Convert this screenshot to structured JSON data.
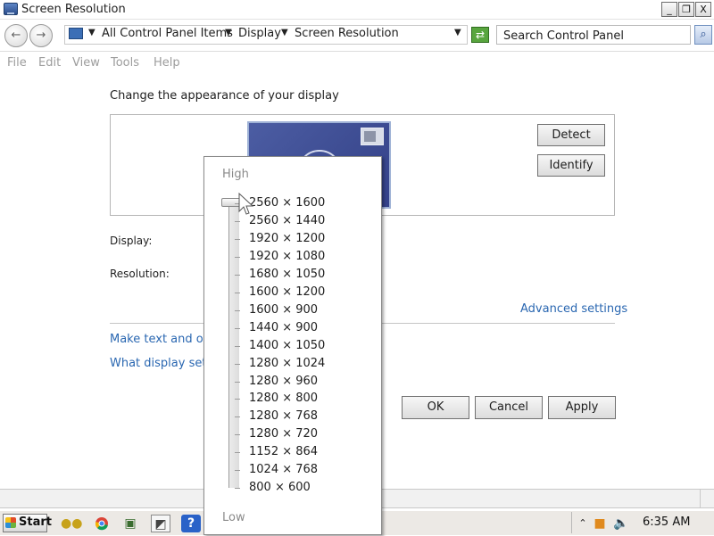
{
  "window": {
    "title": "Screen Resolution",
    "controls": {
      "minimize": "_",
      "restore": "❐",
      "close": "X"
    }
  },
  "address_bar": {
    "breadcrumbs": [
      "All Control Panel Items",
      "Display",
      "Screen Resolution"
    ],
    "search_placeholder": "Search Control Panel"
  },
  "menu": [
    "File",
    "Edit",
    "View",
    "Tools",
    "Help"
  ],
  "content": {
    "heading": "Change the appearance of your display",
    "detect_label": "Detect",
    "identify_label": "Identify",
    "display_label": "Display:",
    "resolution_label": "Resolution:",
    "advanced_link": "Advanced settings",
    "links": [
      "Make text and other items larger or smaller",
      "What display settings should I choose?"
    ],
    "buttons": {
      "ok": "OK",
      "cancel": "Cancel",
      "apply": "Apply"
    }
  },
  "resolution_dropdown": {
    "high_label": "High",
    "low_label": "Low",
    "selected": "2560 × 1600",
    "options": [
      "2560 × 1600",
      "2560 × 1440",
      "1920 × 1200",
      "1920 × 1080",
      "1680 × 1050",
      "1600 × 1200",
      "1600 × 900",
      "1440 × 900",
      "1400 × 1050",
      "1280 × 1024",
      "1280 × 960",
      "1280 × 800",
      "1280 × 768",
      "1280 × 720",
      "1152 × 864",
      "1024 × 768",
      "800 × 600"
    ]
  },
  "taskbar": {
    "start_label": "Start",
    "clock": "6:35 AM"
  },
  "colors": {
    "link": "#2a67b1",
    "monitor": "#3e4d93",
    "disabled_text": "#9c9c9c"
  }
}
